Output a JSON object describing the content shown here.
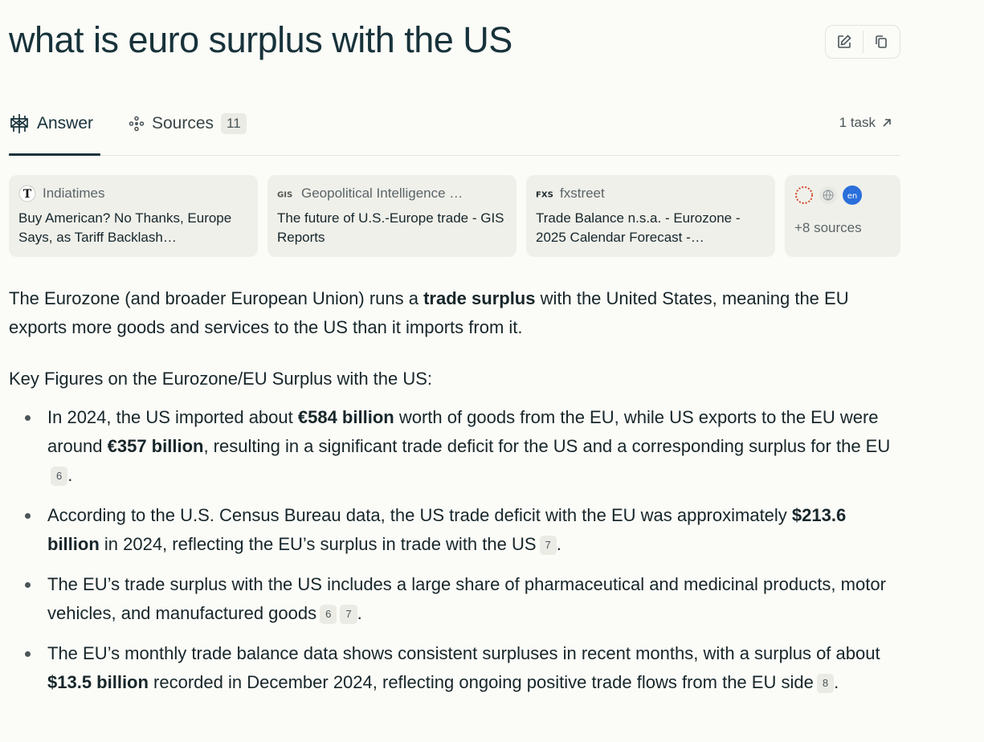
{
  "query_title": "what is euro surplus with the US",
  "tabs": {
    "answer_label": "Answer",
    "sources_label": "Sources",
    "sources_count": "11",
    "task_label": "1 task"
  },
  "sources": [
    {
      "site": "Indiatimes",
      "title": "Buy American? No Thanks, Europe Says, as Tariff Backlash…",
      "logo": "T"
    },
    {
      "site": "Geopolitical Intelligence …",
      "title": "The future of U.S.-Europe trade - GIS Reports",
      "logo": "GIS"
    },
    {
      "site": "fxstreet",
      "title": "Trade Balance n.s.a. - Eurozone - 2025 Calendar Forecast -…",
      "logo": "FXS"
    }
  ],
  "more_sources": {
    "label": "+8 sources",
    "badge": "en"
  },
  "answer": {
    "intro_a": "The Eurozone (and broader European Union) runs a ",
    "intro_b": "trade surplus",
    "intro_c": " with the United States, meaning the EU exports more goods and services to the US than it imports from it.",
    "heading": "Key Figures on the Eurozone/EU Surplus with the US:",
    "b1_a": "In 2024, the US imported about ",
    "b1_b": "€584 billion",
    "b1_c": " worth of goods from the EU, while US exports to the EU were around ",
    "b1_d": "€357 billion",
    "b1_e": ", resulting in a significant trade deficit for the US and a corresponding surplus for the EU",
    "b1_cite": "6",
    "b2_a": "According to the U.S. Census Bureau data, the US trade deficit with the EU was approximately ",
    "b2_b": "$213.6 billion",
    "b2_c": " in 2024, reflecting the EU’s surplus in trade with the US",
    "b2_cite": "7",
    "b3_a": "The EU’s trade surplus with the US includes a large share of pharmaceutical and medicinal products, motor vehicles, and manufactured goods",
    "b3_cite1": "6",
    "b3_cite2": "7",
    "b4_a": "The EU’s monthly trade balance data shows consistent surpluses in recent months, with a surplus of about ",
    "b4_b": "$13.5 billion",
    "b4_c": " recorded in December 2024, reflecting ongoing positive trade flows from the EU side",
    "b4_cite": "8",
    "period": "."
  }
}
